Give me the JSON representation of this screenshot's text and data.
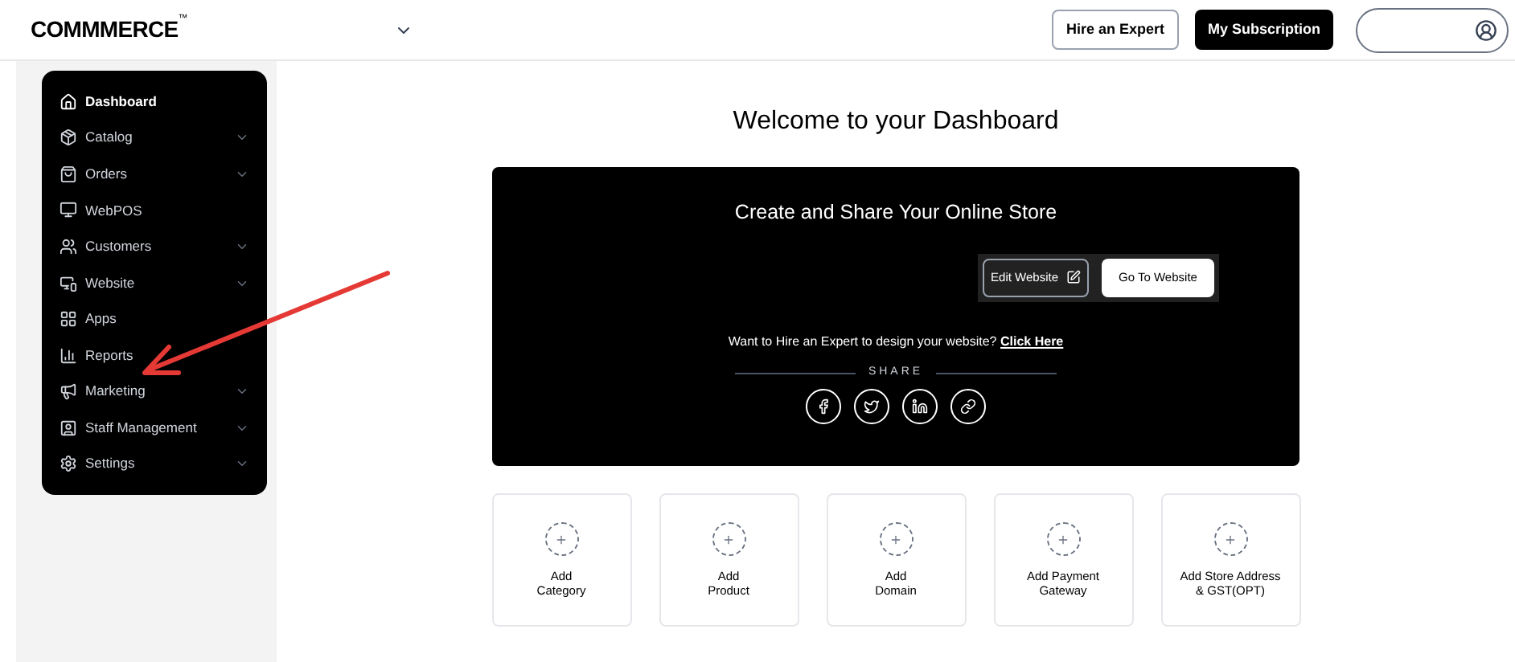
{
  "header": {
    "logo": "COMMMERCE",
    "logo_mark": "™",
    "buttons": [
      {
        "label": "Hire an Expert",
        "kind": "outline"
      },
      {
        "label": "My Subscription",
        "kind": "solid"
      }
    ]
  },
  "sidebar": {
    "items": [
      {
        "label": "Dashboard",
        "selected": true,
        "expandable": false
      },
      {
        "label": "Catalog",
        "selected": false,
        "expandable": true
      },
      {
        "label": "Orders",
        "selected": false,
        "expandable": true
      },
      {
        "label": "WebPOS",
        "selected": false,
        "expandable": false
      },
      {
        "label": "Customers",
        "selected": false,
        "expandable": true
      },
      {
        "label": "Website",
        "selected": false,
        "expandable": true
      },
      {
        "label": "Apps",
        "selected": false,
        "expandable": false
      },
      {
        "label": "Reports",
        "selected": false,
        "expandable": false
      },
      {
        "label": "Marketing",
        "selected": false,
        "expandable": true
      },
      {
        "label": "Staff Management",
        "selected": false,
        "expandable": true
      },
      {
        "label": "Settings",
        "selected": false,
        "expandable": true
      }
    ]
  },
  "main": {
    "title": "Welcome to your Dashboard",
    "banner": {
      "title": "Create and Share Your Online Store",
      "edit_button": "Edit Website",
      "go_button": "Go To Website",
      "hire_text": "Want to Hire an Expert to design your website?",
      "hire_link": "Click Here",
      "share_label": "SHARE"
    },
    "cards": [
      {
        "label": "Add\nCategory"
      },
      {
        "label": "Add\nProduct"
      },
      {
        "label": "Add\nDomain"
      },
      {
        "label": "Add Payment\nGateway"
      },
      {
        "label": "Add Store Address\n& GST(OPT)"
      }
    ]
  }
}
